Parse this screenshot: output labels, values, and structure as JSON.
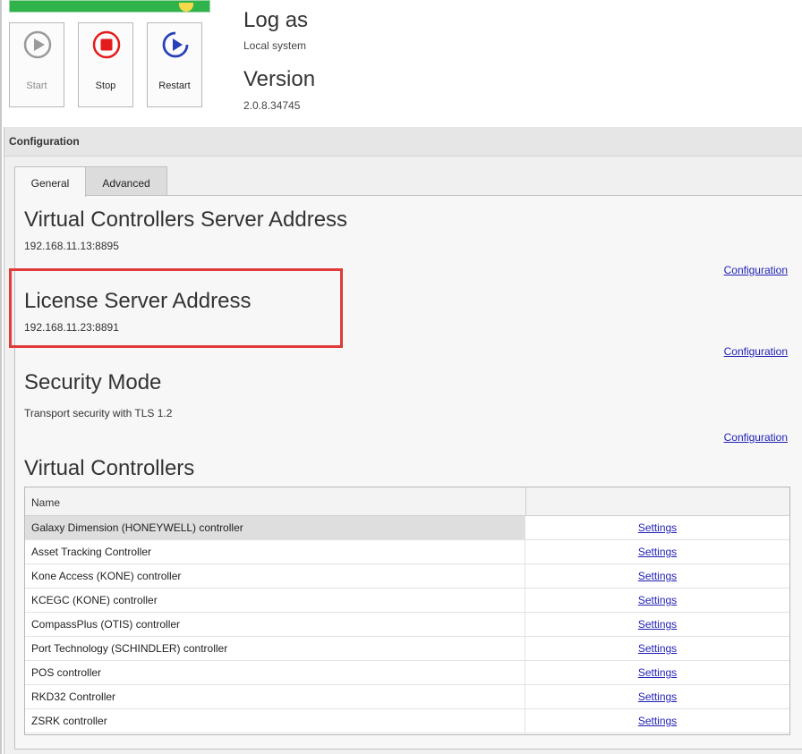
{
  "service": {
    "buttons": [
      {
        "label": "Start",
        "icon": "play-circle-icon",
        "enabled": false,
        "color": "#9a9a9a"
      },
      {
        "label": "Stop",
        "icon": "stop-circle-icon",
        "enabled": true,
        "color": "#e31b1b"
      },
      {
        "label": "Restart",
        "icon": "restart-play-icon",
        "enabled": true,
        "color": "#2741b8"
      }
    ],
    "log_as_title": "Log as",
    "log_as_value": "Local system",
    "version_title": "Version",
    "version_value": "2.0.8.34745",
    "status_color": "#2fb34a"
  },
  "configuration": {
    "header": "Configuration",
    "tabs": [
      {
        "label": "General",
        "active": true
      },
      {
        "label": "Advanced",
        "active": false
      }
    ],
    "sections": {
      "virtual_controllers_server": {
        "title": "Virtual Controllers Server Address",
        "value": "192.168.11.13:8895",
        "link": "Configuration"
      },
      "license_server": {
        "title": "License Server Address",
        "value": "192.168.11.23:8891",
        "link": "Configuration",
        "highlight_color": "#e03a3a"
      },
      "security_mode": {
        "title": "Security Mode",
        "value": "Transport security with TLS 1.2",
        "link": "Configuration"
      }
    },
    "virtual_controllers": {
      "title": "Virtual Controllers",
      "columns": [
        "Name",
        ""
      ],
      "rows": [
        {
          "name": "Galaxy Dimension (HONEYWELL) controller",
          "action": "Settings",
          "selected": true
        },
        {
          "name": "Asset Tracking Controller",
          "action": "Settings"
        },
        {
          "name": "Kone Access (KONE) controller",
          "action": "Settings"
        },
        {
          "name": "KCEGC (KONE) controller",
          "action": "Settings"
        },
        {
          "name": "CompassPlus (OTIS) controller",
          "action": "Settings"
        },
        {
          "name": "Port Technology (SCHINDLER) controller",
          "action": "Settings"
        },
        {
          "name": "POS controller",
          "action": "Settings"
        },
        {
          "name": "RKD32 Controller",
          "action": "Settings"
        },
        {
          "name": "ZSRK controller",
          "action": "Settings"
        }
      ]
    }
  }
}
